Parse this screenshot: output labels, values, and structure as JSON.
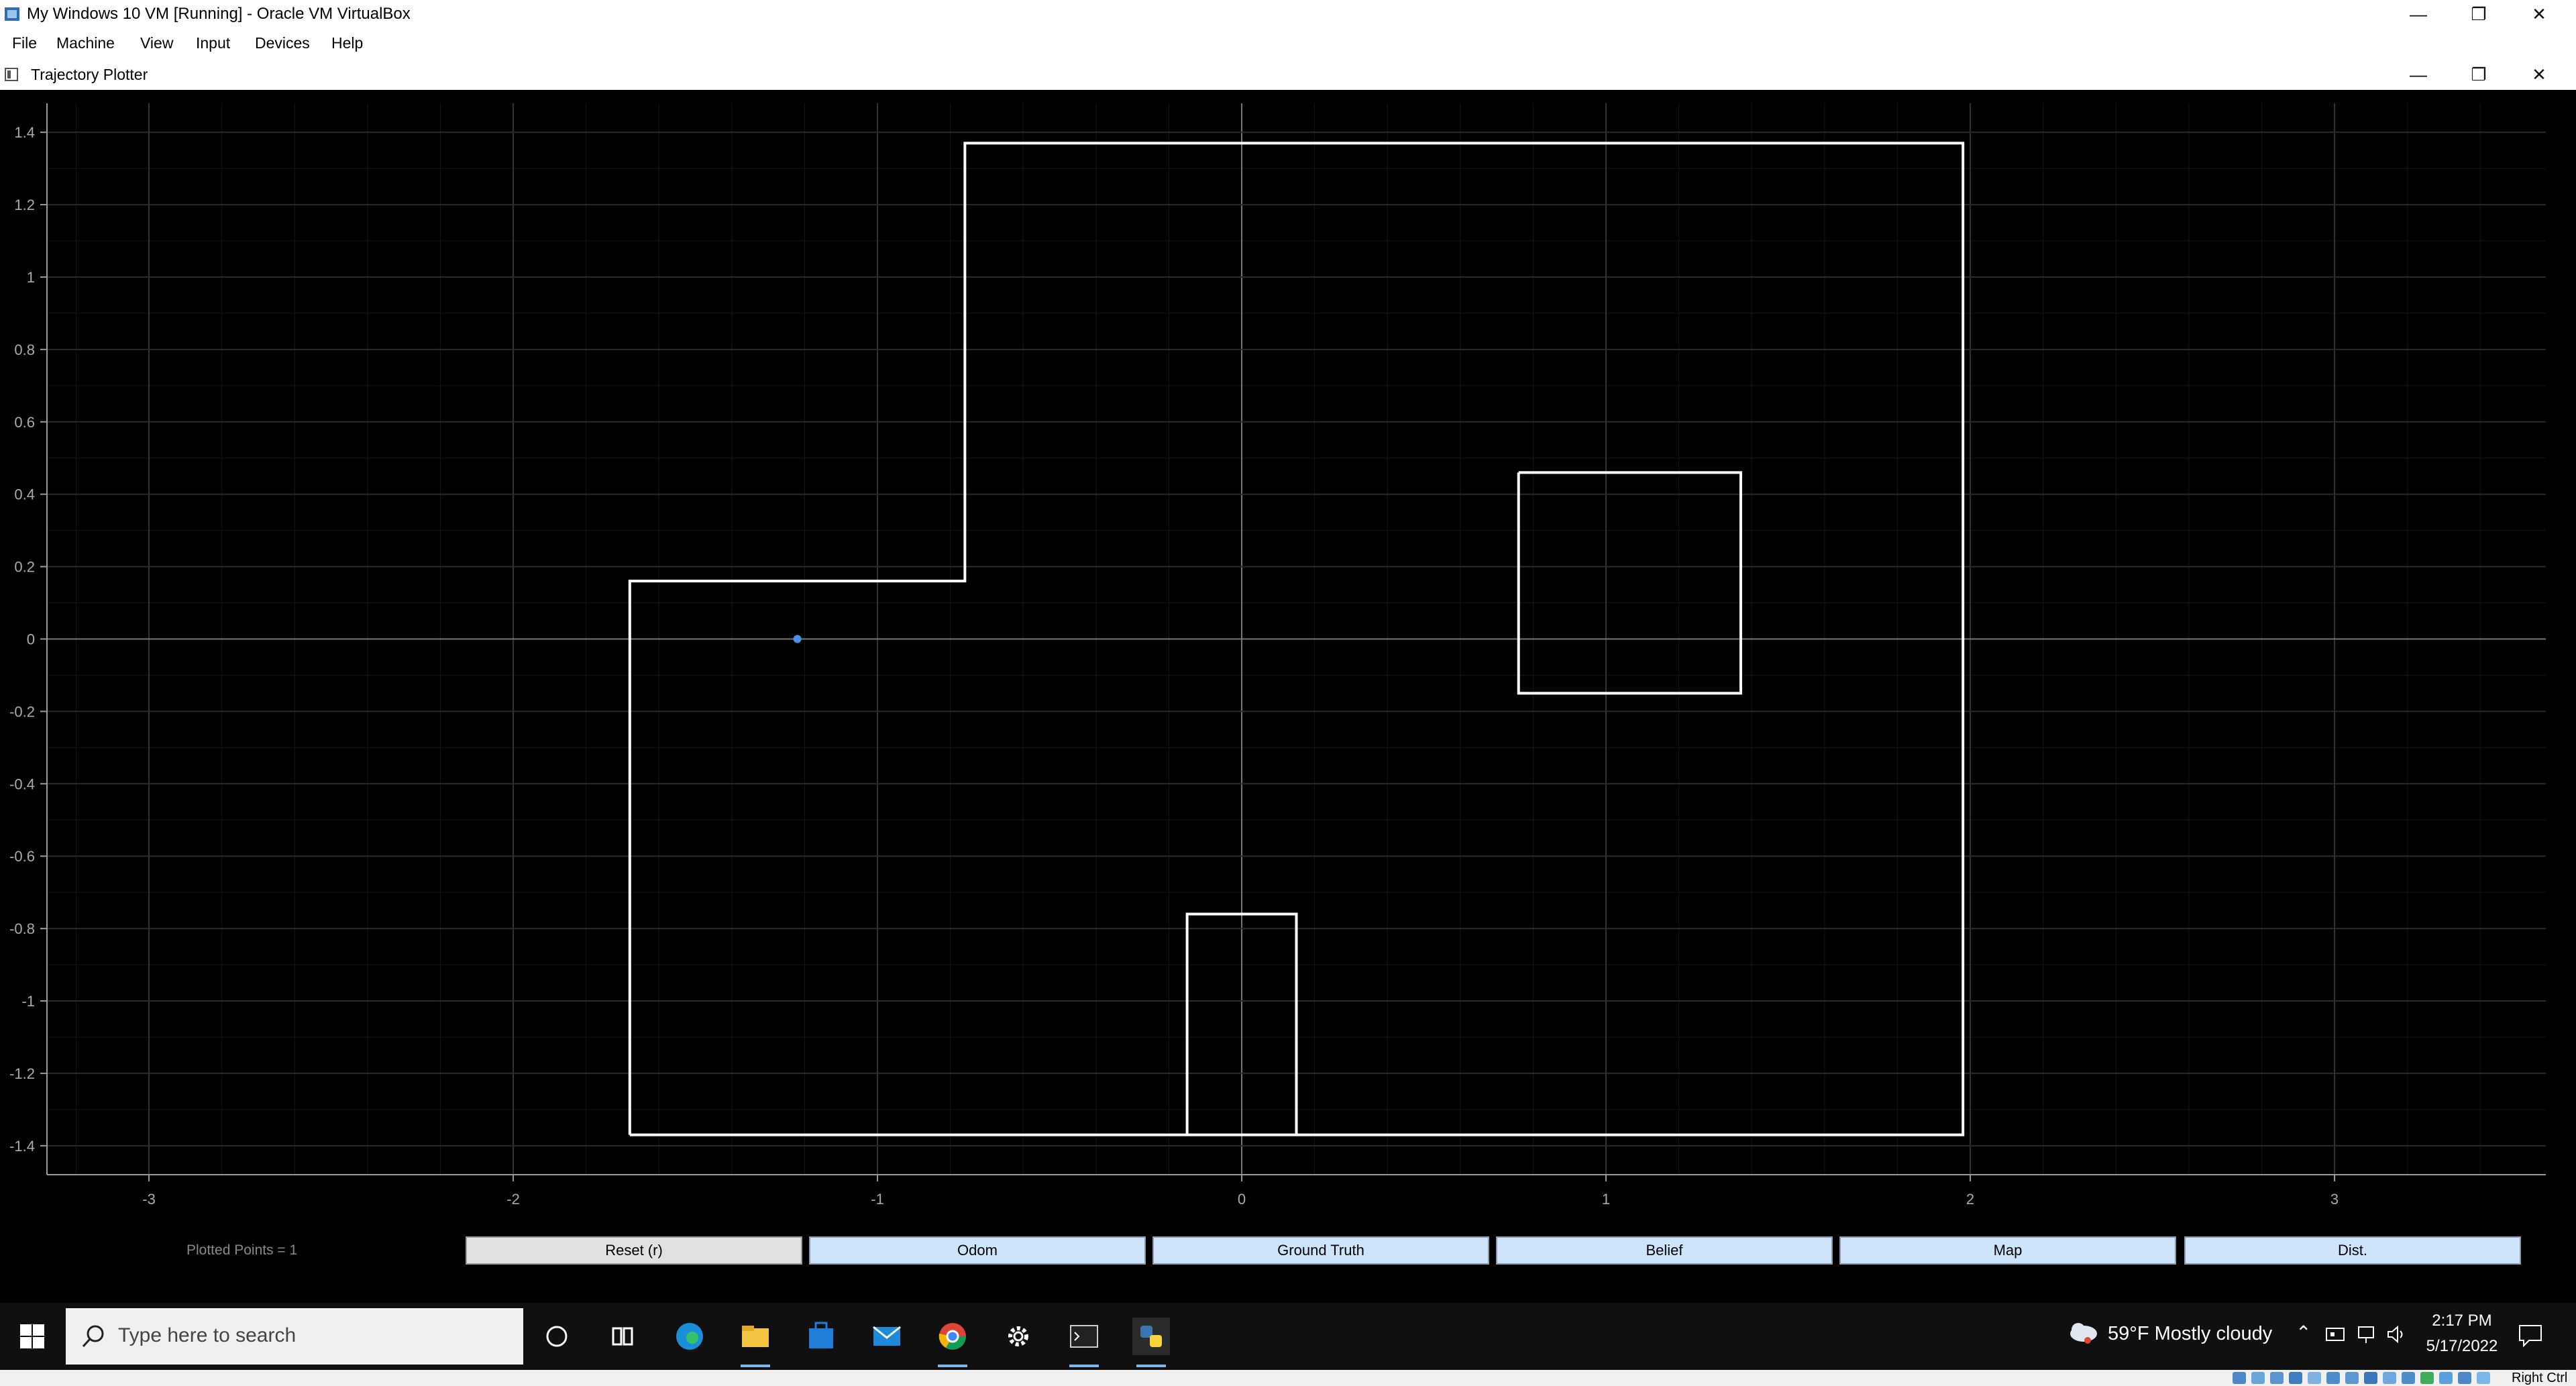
{
  "vbox": {
    "title": "My Windows 10 VM [Running] - Oracle VM VirtualBox",
    "menu": [
      "File",
      "Machine",
      "View",
      "Input",
      "Devices",
      "Help"
    ],
    "status_host_key": "Right Ctrl"
  },
  "app": {
    "title": "Trajectory Plotter",
    "plotted_points_label": "Plotted Points = 1",
    "buttons": {
      "reset": "Reset (r)",
      "odom": "Odom",
      "ground_truth": "Ground Truth",
      "belief": "Belief",
      "map": "Map",
      "dist": "Dist."
    }
  },
  "chart_data": {
    "type": "scatter",
    "title": "",
    "xlabel": "",
    "ylabel": "",
    "xlim": [
      -3.28,
      3.58
    ],
    "ylim": [
      -1.48,
      1.48
    ],
    "x_ticks": [
      -3,
      -2,
      -1,
      0,
      1,
      2,
      3
    ],
    "x_tick_labels": [
      "-3",
      "-2",
      "-1",
      "0",
      "1",
      "2",
      "3"
    ],
    "y_ticks": [
      1.4,
      1.2,
      1.0,
      0.8,
      0.6,
      0.4,
      0.2,
      0.0,
      -0.2,
      -0.4,
      -0.6,
      -0.8,
      -1.0,
      -1.2,
      -1.4
    ],
    "y_tick_labels": [
      "1.4",
      "1.2",
      "1",
      "0.8",
      "0.6",
      "0.4",
      "0.2",
      "0",
      "-0.2",
      "-0.4",
      "-0.6",
      "-0.8",
      "-1",
      "-1.2",
      "-1.4"
    ],
    "grid": true,
    "map_walls": [
      {
        "name": "outer-wall",
        "points": [
          [
            -1.68,
            -1.37
          ],
          [
            1.98,
            -1.37
          ],
          [
            1.98,
            1.37
          ],
          [
            -0.76,
            1.37
          ],
          [
            -0.76,
            0.16
          ],
          [
            -1.68,
            0.16
          ],
          [
            -1.68,
            -1.37
          ]
        ]
      },
      {
        "name": "square-obstacle",
        "points": [
          [
            0.76,
            0.46
          ],
          [
            1.37,
            0.46
          ],
          [
            1.37,
            -0.15
          ],
          [
            0.76,
            -0.15
          ],
          [
            0.76,
            0.46
          ]
        ]
      },
      {
        "name": "bottom-obstacle",
        "points": [
          [
            -0.15,
            -1.37
          ],
          [
            -0.15,
            -0.76
          ],
          [
            0.15,
            -0.76
          ],
          [
            0.15,
            -1.37
          ]
        ]
      }
    ],
    "points": [
      {
        "x": -1.22,
        "y": 0.0
      }
    ],
    "colors": {
      "walls": "#ffffff",
      "point": "#4a90e2",
      "grid": "#2a2a2a",
      "axis": "#777777"
    }
  },
  "taskbar": {
    "search_placeholder": "Type here to search",
    "weather": "59°F  Mostly cloudy",
    "time": "2:17 PM",
    "date": "5/17/2022",
    "pinned_icons": [
      "cortana-icon",
      "task-view-icon",
      "edge-icon",
      "file-explorer-icon",
      "store-icon",
      "mail-icon",
      "chrome-icon",
      "settings-icon",
      "terminal-icon",
      "python-icon"
    ]
  }
}
